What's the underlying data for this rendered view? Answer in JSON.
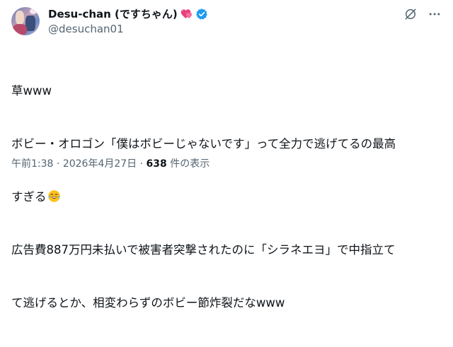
{
  "author": {
    "display_name": "Desu-chan (ですちゃん)",
    "handle": "@desuchan01",
    "avatar_icon": "profile-avatar",
    "badge_icon": "verified-badge-icon",
    "badge_color": "#1d9bf0",
    "name_emoji": "heart-icon"
  },
  "actions": {
    "grok_icon": "grok-icon",
    "more_icon": "more-icon"
  },
  "tweet": {
    "lines": [
      "草www",
      "ボビー・オロゴン「僕はボビーじゃないです」って全力で逃げてるの最高",
      "すぎる",
      "広告費887万円未払いで被害者突撃されたのに「シラネエヨ」で中指立て",
      "て逃げるとか、相変わらずのボビー節炸裂だなwww"
    ],
    "emoji": "laughing-tears-emoji"
  },
  "meta": {
    "time": "午前1:38",
    "separator": " · ",
    "date": "2026年4月27日",
    "views_count": "638",
    "views_label": " 件の表示"
  },
  "colors": {
    "text": "#0f1419",
    "secondary": "#536471",
    "accent": "#1d9bf0"
  }
}
